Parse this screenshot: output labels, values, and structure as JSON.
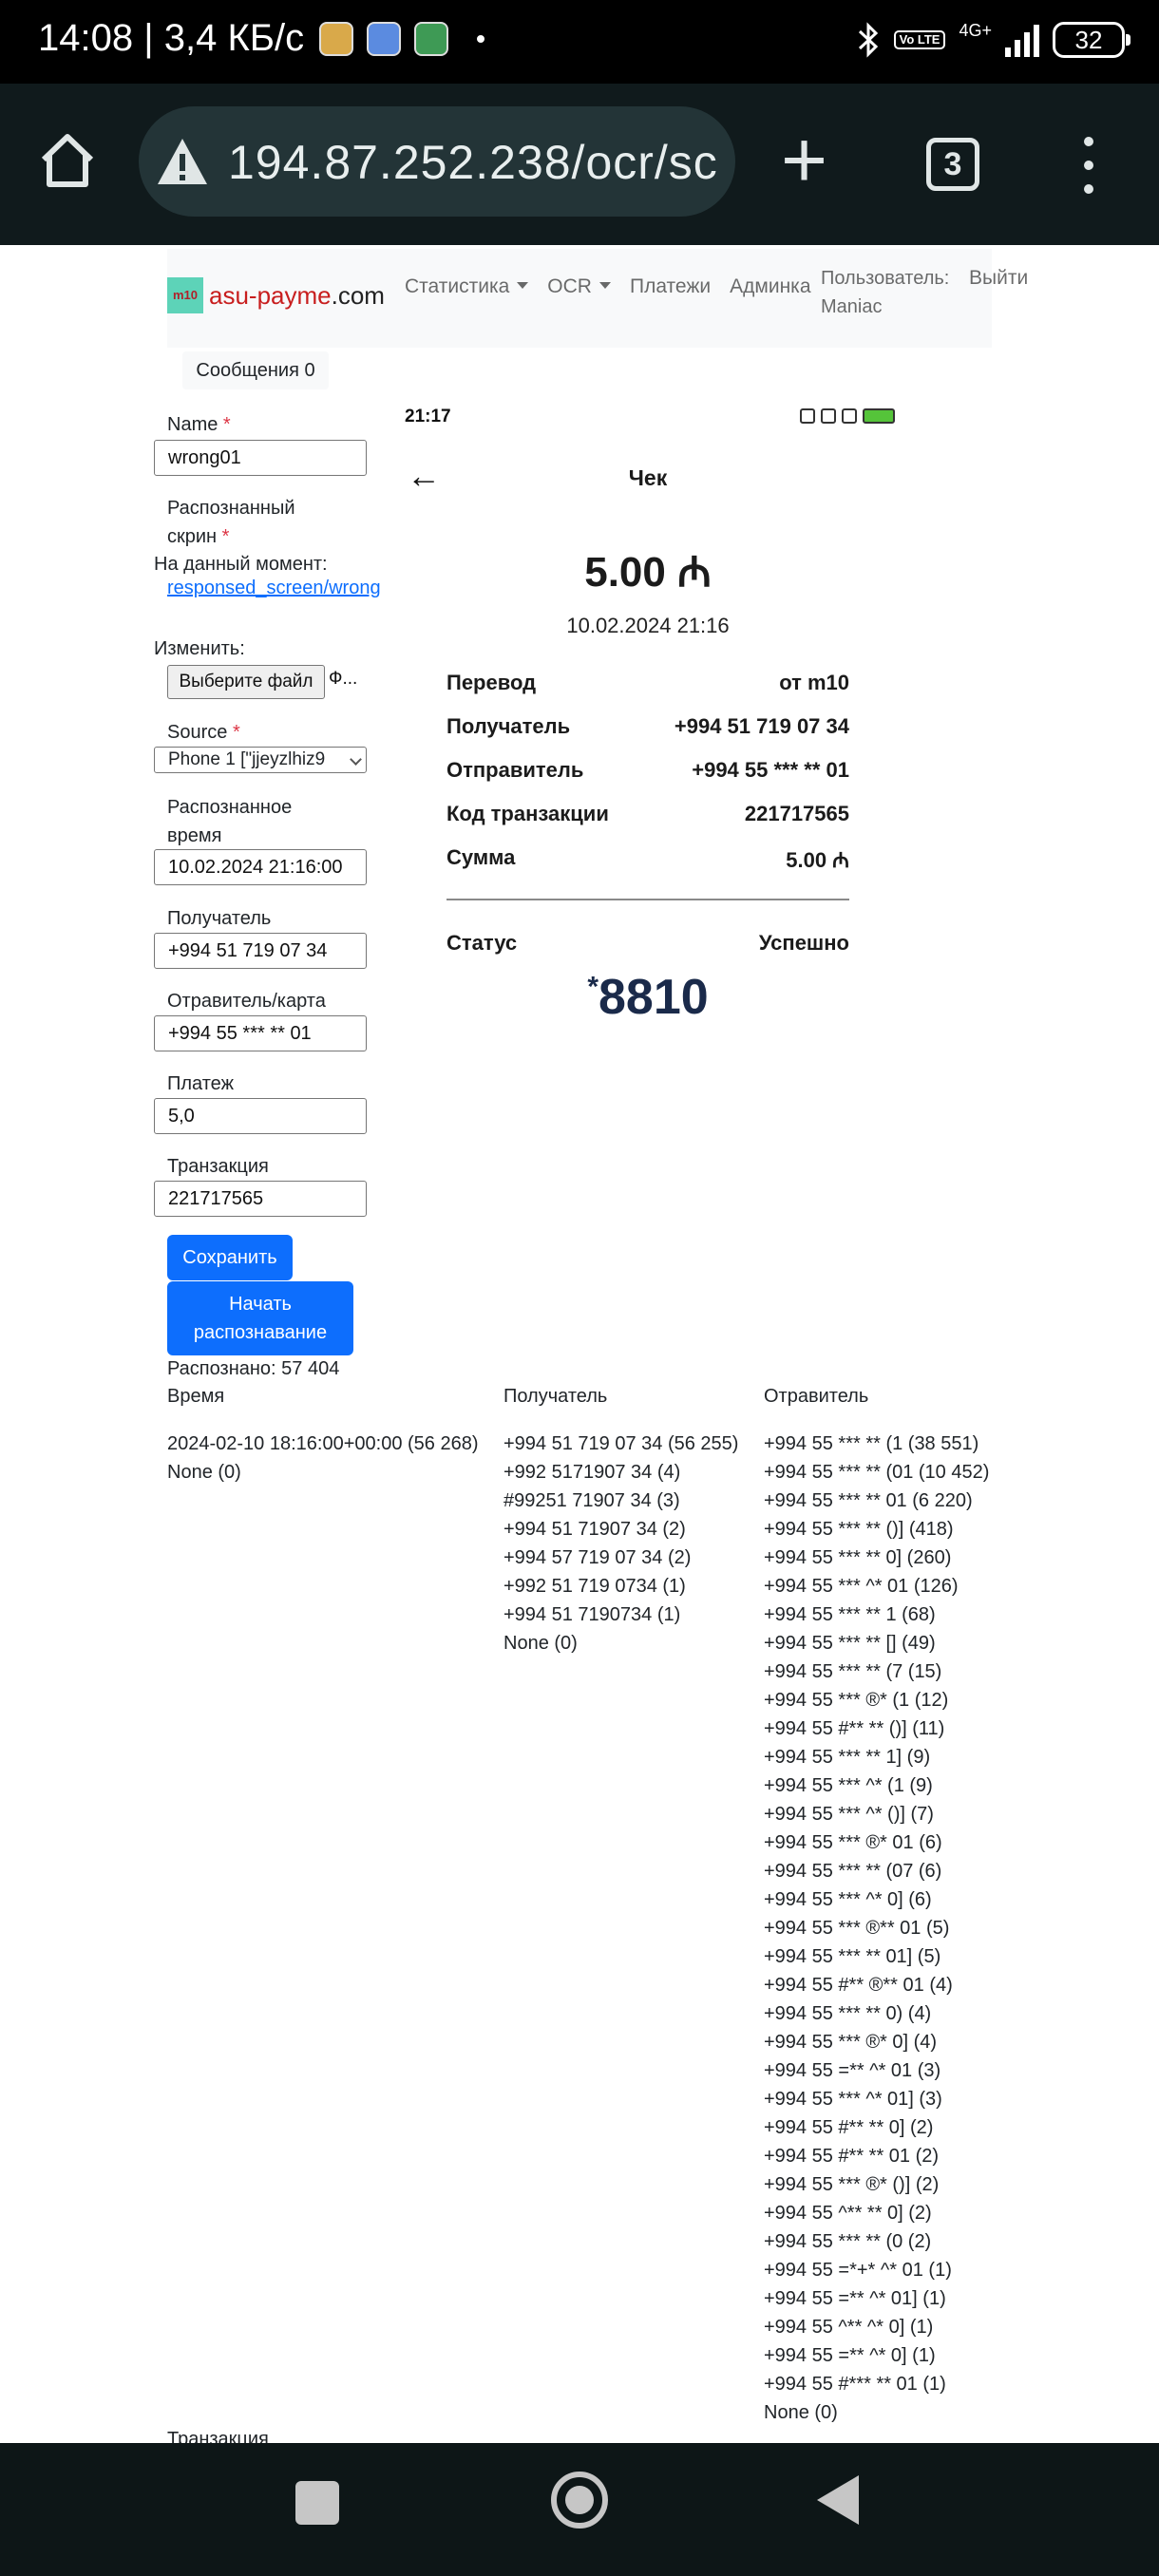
{
  "status_bar": {
    "time": "14:08",
    "network_speed": "3,4 КБ/с",
    "volte": "Vo LTE",
    "network_type": "4G+",
    "battery": "32"
  },
  "browser": {
    "url": "194.87.252.238/ocr/sc",
    "tab_count": "3"
  },
  "navbar": {
    "brand_a": "asu-payme",
    "brand_b": ".com",
    "brand_logo": "m10",
    "links": [
      "Статистика",
      "OCR",
      "Платежи",
      "Админка"
    ],
    "user": "Пользователь: Maniac",
    "logout": "Выйти"
  },
  "messages": "Сообщения 0",
  "form": {
    "name_label": "Name",
    "name_value": "wrong01",
    "screen_label": "Распознанный скрин",
    "current_label": "На данный момент:",
    "current_link": "responsed_screen/wrong",
    "change_label": "Изменить:",
    "file_button": "Выберите файл",
    "file_name": "Ф...",
    "source_label": "Source",
    "source_value": "Phone 1 [\"jjeyzlhiz9",
    "time_label": "Распознанное время",
    "time_value": "10.02.2024 21:16:00",
    "recipient_label": "Получатель",
    "recipient_value": "+994 51 719 07 34",
    "sender_label": "Отравитель/карта",
    "sender_value": "+994 55 *** ** 01",
    "payment_label": "Платеж",
    "payment_value": "5,0",
    "transaction_label": "Транзакция",
    "transaction_value": "221717565",
    "save_button": "Сохранить",
    "start_button": "Начать распознавание"
  },
  "receipt": {
    "time": "21:17",
    "title": "Чек",
    "amount": "5.00 ₼",
    "date": "10.02.2024 21:16",
    "rows": [
      {
        "label": "Перевод",
        "value": "от m10"
      },
      {
        "label": "Получатель",
        "value": "+994 51 719 07 34"
      },
      {
        "label": "Отправитель",
        "value": "+994 55 *** ** 01"
      },
      {
        "label": "Код транзакции",
        "value": "221717565"
      },
      {
        "label": "Сумма",
        "value": "5.00 ₼"
      }
    ],
    "status_label": "Статус",
    "status_value": "Успешно",
    "logo_star": "*",
    "logo_text": "8810"
  },
  "stats": {
    "recognized": "Распознано: 57 404",
    "time_header": "Время",
    "recipient_header": "Получатель",
    "sender_header": "Отравитель",
    "times": [
      "2024-02-10 18:16:00+00:00 (56 268)",
      "None (0)"
    ],
    "recipients": [
      "+994 51 719 07 34 (56 255)",
      "+992 5171907 34 (4)",
      "#99251 71907 34 (3)",
      "+994 51 71907 34 (2)",
      "+994 57 719 07 34 (2)",
      "+992 51 719 0734 (1)",
      "+994 51 7190734 (1)",
      "None (0)"
    ],
    "senders": [
      "+994 55 *** ** (1 (38 551)",
      "+994 55 *** ** (01 (10 452)",
      "+994 55 *** ** 01 (6 220)",
      "+994 55 *** ** ()] (418)",
      "+994 55 *** ** 0] (260)",
      "+994 55 *** ^* 01 (126)",
      "+994 55 *** ** 1 (68)",
      "+994 55 *** ** [] (49)",
      "+994 55 *** ** (7 (15)",
      "+994 55 *** ®* (1 (12)",
      "+994 55 #** ** ()] (11)",
      "+994 55 *** ** 1] (9)",
      "+994 55 *** ^* (1 (9)",
      "+994 55 *** ^* ()] (7)",
      "+994 55 *** ®* 01 (6)",
      "+994 55 *** ** (07 (6)",
      "+994 55 *** ^* 0] (6)",
      "+994 55 *** ®** 01 (5)",
      "+994 55 *** ** 01] (5)",
      "+994 55 #** ®** 01 (4)",
      "+994 55 *** ** 0) (4)",
      "+994 55 *** ®* 0] (4)",
      "+994 55 =** ^* 01 (3)",
      "+994 55 *** ^* 01] (3)",
      "+994 55 #** ** 0] (2)",
      "+994 55 #** ** 01 (2)",
      "+994 55 *** ®* ()] (2)",
      "+994 55 ^** ** 0] (2)",
      "+994 55 *** ** (0 (2)",
      "+994 55 =*+* ^* 01 (1)",
      "+994 55 =** ^* 01] (1)",
      "+994 55 ^** ^* 0] (1)",
      "+994 55 =** ^* 0] (1)",
      "+994 55 #*** ** 01 (1)",
      "None (0)"
    ],
    "footer_label": "Транзакция"
  },
  "colors": {
    "primary": "#0d6efd",
    "required": "#dc3545",
    "brand_red": "#c81e1e"
  }
}
